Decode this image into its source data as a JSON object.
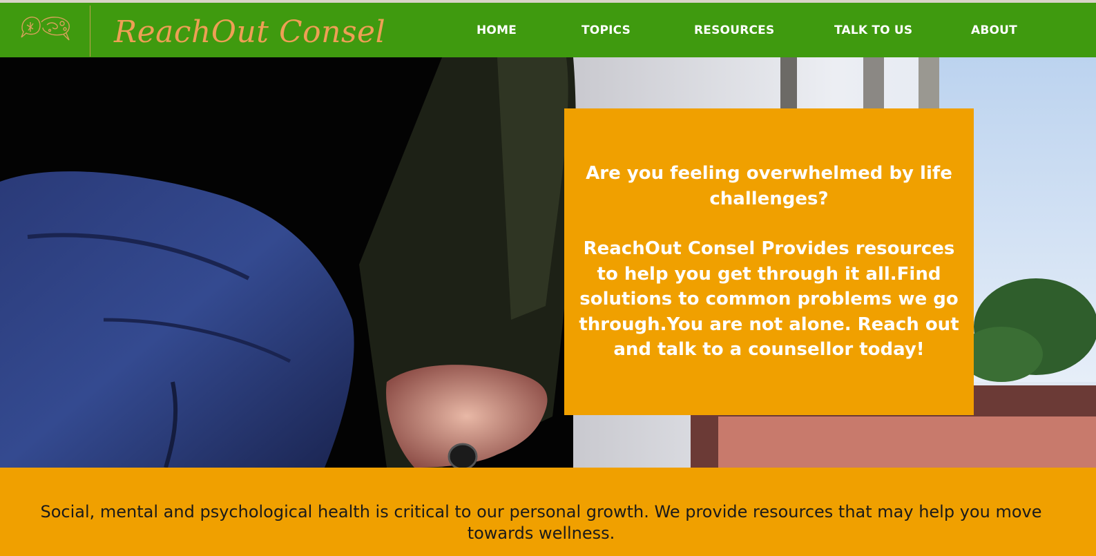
{
  "header": {
    "brand": "ReachOut Consel",
    "logo_icon": "speech-bubbles-logo-icon",
    "nav": [
      {
        "label": "HOME"
      },
      {
        "label": "TOPICS"
      },
      {
        "label": "RESOURCES"
      },
      {
        "label": "TALK TO US"
      },
      {
        "label": "ABOUT"
      }
    ],
    "colors": {
      "nav_background": "#3f9a0f",
      "brand_text": "#ee9f55",
      "nav_text": "#ffffff"
    }
  },
  "hero": {
    "question": "Are you feeling overwhelmed by life challenges?",
    "message": "ReachOut Consel Provides resources to help you get through it all.Find solutions to common problems we go through.You are not alone. Reach out and talk to a counsellor today!",
    "card_color": "#f0a000"
  },
  "intro": {
    "text": "Social, mental and psychological health is critical to our personal growth. We provide resources that may help you move towards wellness.",
    "band_color": "#f0a000"
  }
}
